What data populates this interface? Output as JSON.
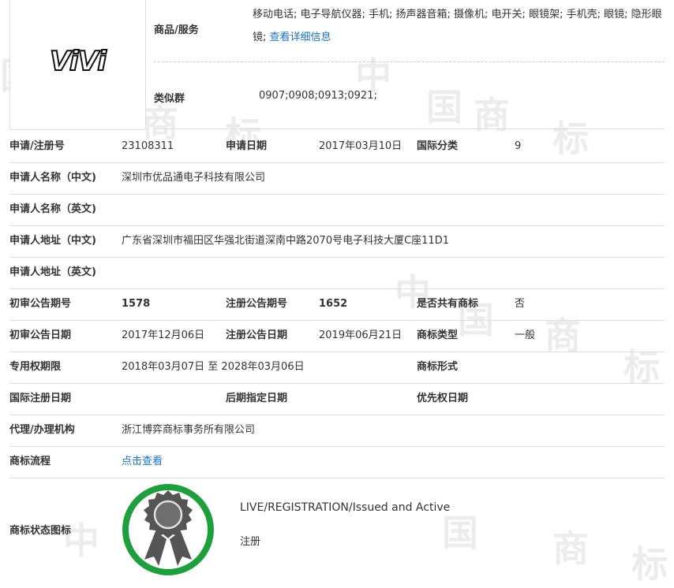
{
  "watermark": {
    "chars": [
      "中",
      "国",
      "商",
      "标"
    ]
  },
  "trademark": {
    "logo_text": "ViVi"
  },
  "goods": {
    "label": "商品/服务",
    "text": "移动电话; 电子导航仪器; 手机; 扬声器音箱; 摄像机; 电开关; 眼镜架; 手机壳; 眼镜; 隐形眼镜;",
    "link": "查看详细信息"
  },
  "similar": {
    "label": "类似群",
    "value": "0907;0908;0913;0921;"
  },
  "fields": {
    "reg_no_label": "申请/注册号",
    "reg_no": "23108311",
    "app_date_label": "申请日期",
    "app_date": "2017年03月10日",
    "intl_class_label": "国际分类",
    "intl_class": "9",
    "applicant_cn_label": "申请人名称（中文)",
    "applicant_cn": "深圳市优品通电子科技有限公司",
    "applicant_en_label": "申请人名称（英文)",
    "applicant_en": "",
    "address_cn_label": "申请人地址（中文)",
    "address_cn": "广东省深圳市福田区华强北街道深南中路2070号电子科技大厦C座11D1",
    "address_en_label": "申请人地址（英文)",
    "address_en": "",
    "prelim_no_label": "初审公告期号",
    "prelim_no": "1578",
    "reg_pub_no_label": "注册公告期号",
    "reg_pub_no": "1652",
    "shared_label": "是否共有商标",
    "shared": "否",
    "prelim_date_label": "初审公告日期",
    "prelim_date": "2017年12月06日",
    "reg_pub_date_label": "注册公告日期",
    "reg_pub_date": "2019年06月21日",
    "tm_type_label": "商标类型",
    "tm_type": "一般",
    "exclusive_label": "专用权期限",
    "exclusive": "2018年03月07日 至 2028年03月06日",
    "tm_form_label": "商标形式",
    "tm_form": "",
    "intl_reg_date_label": "国际注册日期",
    "intl_reg_date": "",
    "later_date_label": "后期指定日期",
    "later_date": "",
    "priority_label": "优先权日期",
    "priority": "",
    "agent_label": "代理/办理机构",
    "agent": "浙江博弈商标事务所有限公司",
    "flow_label": "商标流程",
    "flow_link": "点击查看",
    "status_icon_label": "商标状态图标"
  },
  "status": {
    "en": "LIVE/REGISTRATION/Issued and Active",
    "cn": "注册"
  },
  "colors": {
    "link": "#1a72c2",
    "badge_ring": "#1e9e3c",
    "badge_icon": "#555555",
    "watermark": "#ececec"
  }
}
